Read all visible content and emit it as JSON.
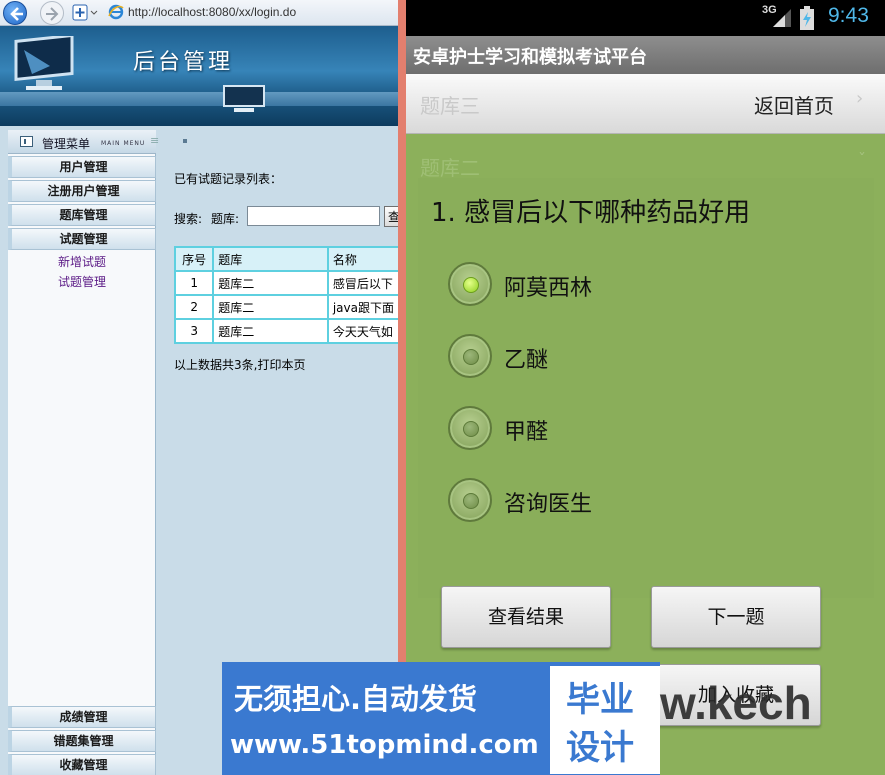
{
  "browser": {
    "url": "http://localhost:8080/xx/login.do"
  },
  "admin": {
    "header_title": "后台管理",
    "menu": {
      "title": "管理菜单",
      "subtitle": "MAIN MENU",
      "groups": [
        "用户管理",
        "注册用户管理",
        "题库管理",
        "试题管理"
      ],
      "sub_items": [
        "新增试题",
        "试题管理"
      ],
      "bottom_groups": [
        "成绩管理",
        "错题集管理",
        "收藏管理"
      ]
    },
    "content": {
      "list_heading": "已有试题记录列表：",
      "search_label": "搜索:",
      "bank_label": "题库:",
      "bank_value": "",
      "query_button": "查",
      "table": {
        "headers": [
          "序号",
          "题库",
          "名称"
        ],
        "rows": [
          [
            "1",
            "题库二",
            "感冒后以下"
          ],
          [
            "2",
            "题库二",
            "java跟下面"
          ],
          [
            "3",
            "题库二",
            "今天天气如"
          ]
        ]
      },
      "total_text": "以上数据共3条,打印本页"
    }
  },
  "phone": {
    "status": {
      "network": "3G",
      "time": "9:43"
    },
    "app_title": "安卓护士学习和模拟考试平台",
    "ghost_bank_3": "题库三",
    "ghost_bank_2": "题库二",
    "home_link": "返回首页",
    "question": "1. 感冒后以下哪种药品好用",
    "options": [
      {
        "label": "阿莫西林",
        "checked": true
      },
      {
        "label": "乙醚",
        "checked": false
      },
      {
        "label": "甲醛",
        "checked": false
      },
      {
        "label": "咨询医生",
        "checked": false
      }
    ],
    "buttons": {
      "view_result": "查看结果",
      "next": "下一题",
      "favorite": "加入收藏"
    }
  },
  "watermark": {
    "line1": "无须担心.自动发货",
    "line2": "www.51topmind.com",
    "badge_line1": "毕业",
    "badge_line2": "设计",
    "url_fragment": "w.kech"
  },
  "colors": {
    "admin_header": "#2a6d9e",
    "table_border": "#5ed0e0",
    "divider": "#e37f6e",
    "phone_bg": "#8cb05b",
    "clock": "#4fb7e8",
    "watermark": "#3a79d0"
  }
}
